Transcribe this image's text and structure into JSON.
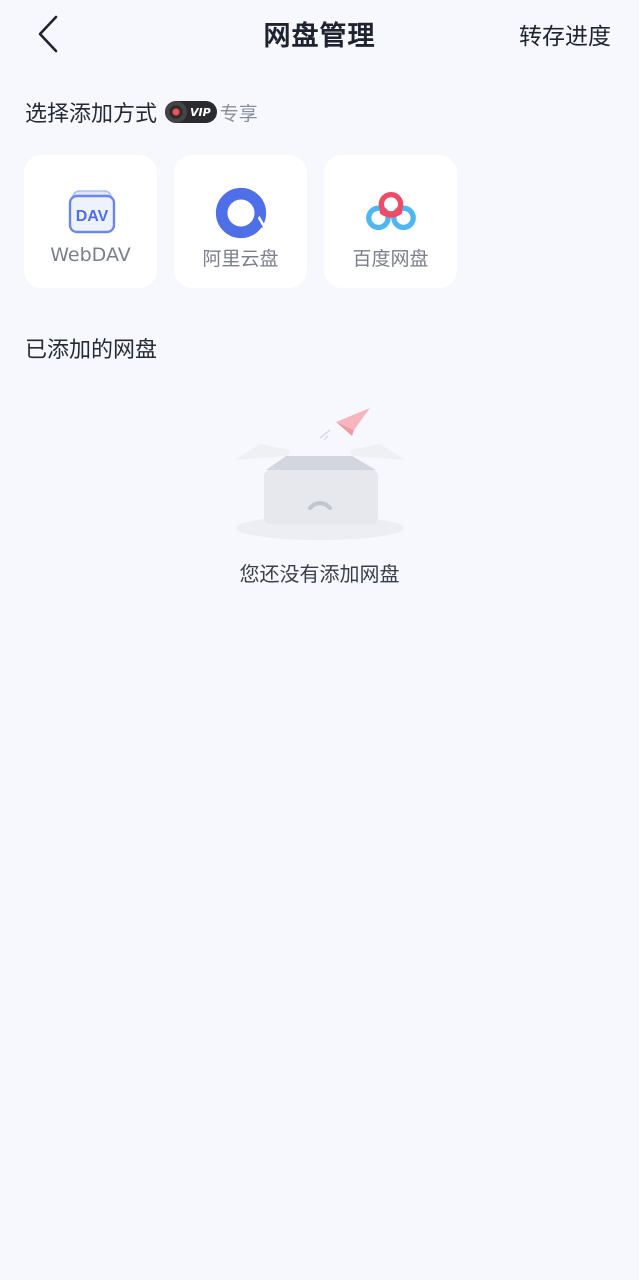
{
  "header": {
    "title": "网盘管理",
    "progress_label": "转存进度",
    "back_icon": "chevron-left-icon"
  },
  "choose": {
    "title": "选择添加方式",
    "vip_badge": "VIP",
    "vip_suffix": "专享"
  },
  "providers": [
    {
      "label": "WebDAV",
      "icon_text": "DAV",
      "icon": "webdav-icon"
    },
    {
      "label": "阿里云盘",
      "icon": "aliyun-drive-icon"
    },
    {
      "label": "百度网盘",
      "icon": "baidu-netdisk-icon"
    }
  ],
  "added": {
    "title": "已添加的网盘",
    "empty_text": "您还没有添加网盘"
  },
  "colors": {
    "background": "#f7f8fd",
    "card": "#ffffff",
    "accent_blue": "#4f6fe8",
    "baidu_red": "#ef4a67",
    "baidu_blue": "#4fb6ef"
  }
}
